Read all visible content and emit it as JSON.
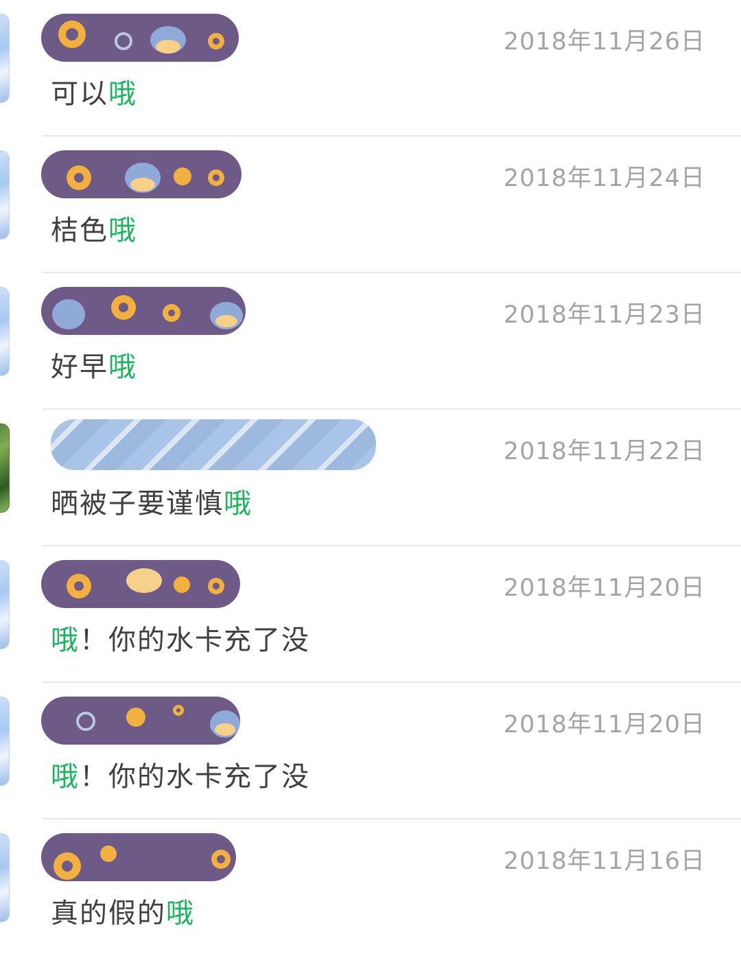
{
  "comments": [
    {
      "date": "2018年11月26日",
      "before": "可以",
      "highlight": "哦",
      "after": "",
      "avatar": "blue",
      "name_style": "purple"
    },
    {
      "date": "2018年11月24日",
      "before": "桔色",
      "highlight": "哦",
      "after": "",
      "avatar": "blue",
      "name_style": "purple"
    },
    {
      "date": "2018年11月23日",
      "before": "好早",
      "highlight": "哦",
      "after": "",
      "avatar": "blue",
      "name_style": "purple"
    },
    {
      "date": "2018年11月22日",
      "before": "晒被子要谨慎",
      "highlight": "哦",
      "after": "",
      "avatar": "green",
      "name_style": "blue"
    },
    {
      "date": "2018年11月20日",
      "before": "",
      "highlight": "哦",
      "after": "！你的水卡充了没",
      "avatar": "blue",
      "name_style": "purple"
    },
    {
      "date": "2018年11月20日",
      "before": "",
      "highlight": "哦",
      "after": "！你的水卡充了没",
      "avatar": "blue",
      "name_style": "purple"
    },
    {
      "date": "2018年11月16日",
      "before": "真的假的",
      "highlight": "哦",
      "after": "",
      "avatar": "blue",
      "name_style": "purple"
    }
  ],
  "colors": {
    "highlight": "#1ab45c",
    "date": "#a4a4a4",
    "text": "#404040",
    "redaction": "#6d5a86"
  }
}
